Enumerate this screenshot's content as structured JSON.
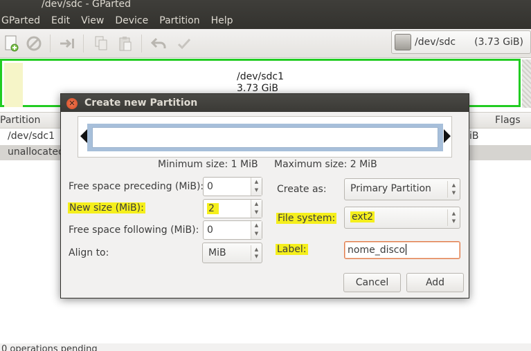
{
  "window": {
    "title": "/dev/sdc - GParted"
  },
  "menubar": {
    "items": [
      "GParted",
      "Edit",
      "View",
      "Device",
      "Partition",
      "Help"
    ]
  },
  "toolbar": {
    "buttons": [
      "new-icon",
      "delete-icon",
      "resize-move-icon",
      "copy-icon",
      "paste-icon",
      "undo-icon",
      "apply-icon"
    ],
    "device_name": "/dev/sdc",
    "device_size": "(3.73 GiB)"
  },
  "graphic": {
    "partition_name": "/dev/sdc1",
    "partition_size": "3.73 GiB"
  },
  "list": {
    "headers": {
      "partition": "Partition",
      "flags": "Flags"
    },
    "rows": [
      {
        "partition": "/dev/sdc1",
        "flags": "iB"
      },
      {
        "partition": "unallocated",
        "flags": ""
      }
    ]
  },
  "status": {
    "text": "0 operations pending"
  },
  "dialog": {
    "title": "Create new Partition",
    "min_size": "Minimum size: 1 MiB",
    "max_size": "Maximum size: 2 MiB",
    "free_preceding_label": "Free space preceding (MiB):",
    "free_preceding_value": "0",
    "new_size_label": "New size (MiB):",
    "new_size_value": "2",
    "free_following_label": "Free space following (MiB):",
    "free_following_value": "0",
    "align_label": "Align to:",
    "align_value": "MiB",
    "create_as_label": "Create as:",
    "create_as_value": "Primary Partition",
    "fs_label": "File system:",
    "fs_value": "ext2",
    "label_label": "Label:",
    "label_value": "nome_disco",
    "cancel": "Cancel",
    "add": "Add"
  },
  "colors": {
    "partition_border": "#22cc22",
    "highlight": "#f5ef1c",
    "title_bar": "#3b3a36"
  }
}
